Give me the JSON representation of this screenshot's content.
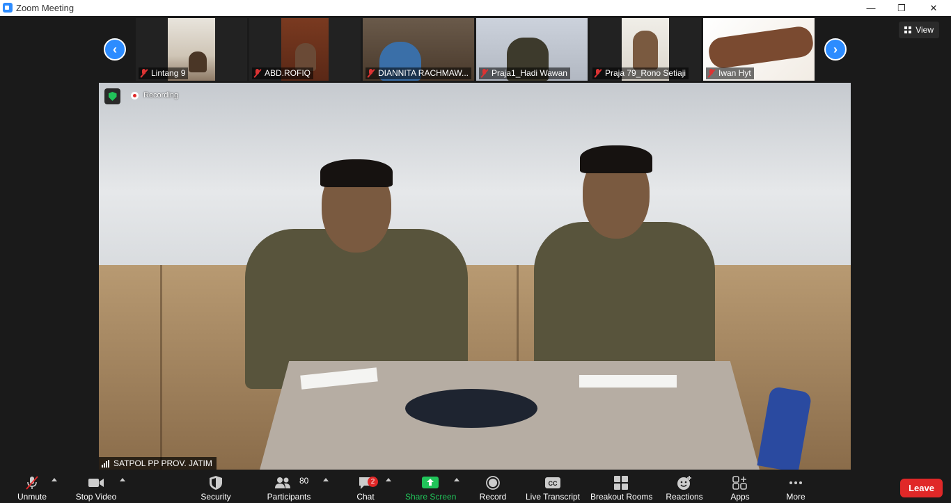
{
  "window": {
    "title": "Zoom Meeting"
  },
  "thumbnails": [
    {
      "name": "Lintang 9"
    },
    {
      "name": "ABD.ROFIQ"
    },
    {
      "name": "DIANNITA RACHMAW..."
    },
    {
      "name": "Praja1_Hadi Wawan"
    },
    {
      "name": "Praja 79_Rono Setiaji"
    },
    {
      "name": "Iwan Hyt"
    }
  ],
  "view_label": "View",
  "main_video": {
    "recording_label": "Recording",
    "speaker_name": "SATPOL PP PROV. JATIM"
  },
  "toolbar": {
    "unmute": "Unmute",
    "stop_video": "Stop Video",
    "security": "Security",
    "participants": "Participants",
    "participants_count": "80",
    "chat": "Chat",
    "chat_badge": "2",
    "share_screen": "Share Screen",
    "record": "Record",
    "live_transcript": "Live Transcript",
    "breakout_rooms": "Breakout Rooms",
    "reactions": "Reactions",
    "apps": "Apps",
    "more": "More",
    "leave": "Leave"
  },
  "colors": {
    "accent": "#2d8cff",
    "leave": "#e02828",
    "share": "#21c45a",
    "background": "#1a1a1a"
  }
}
